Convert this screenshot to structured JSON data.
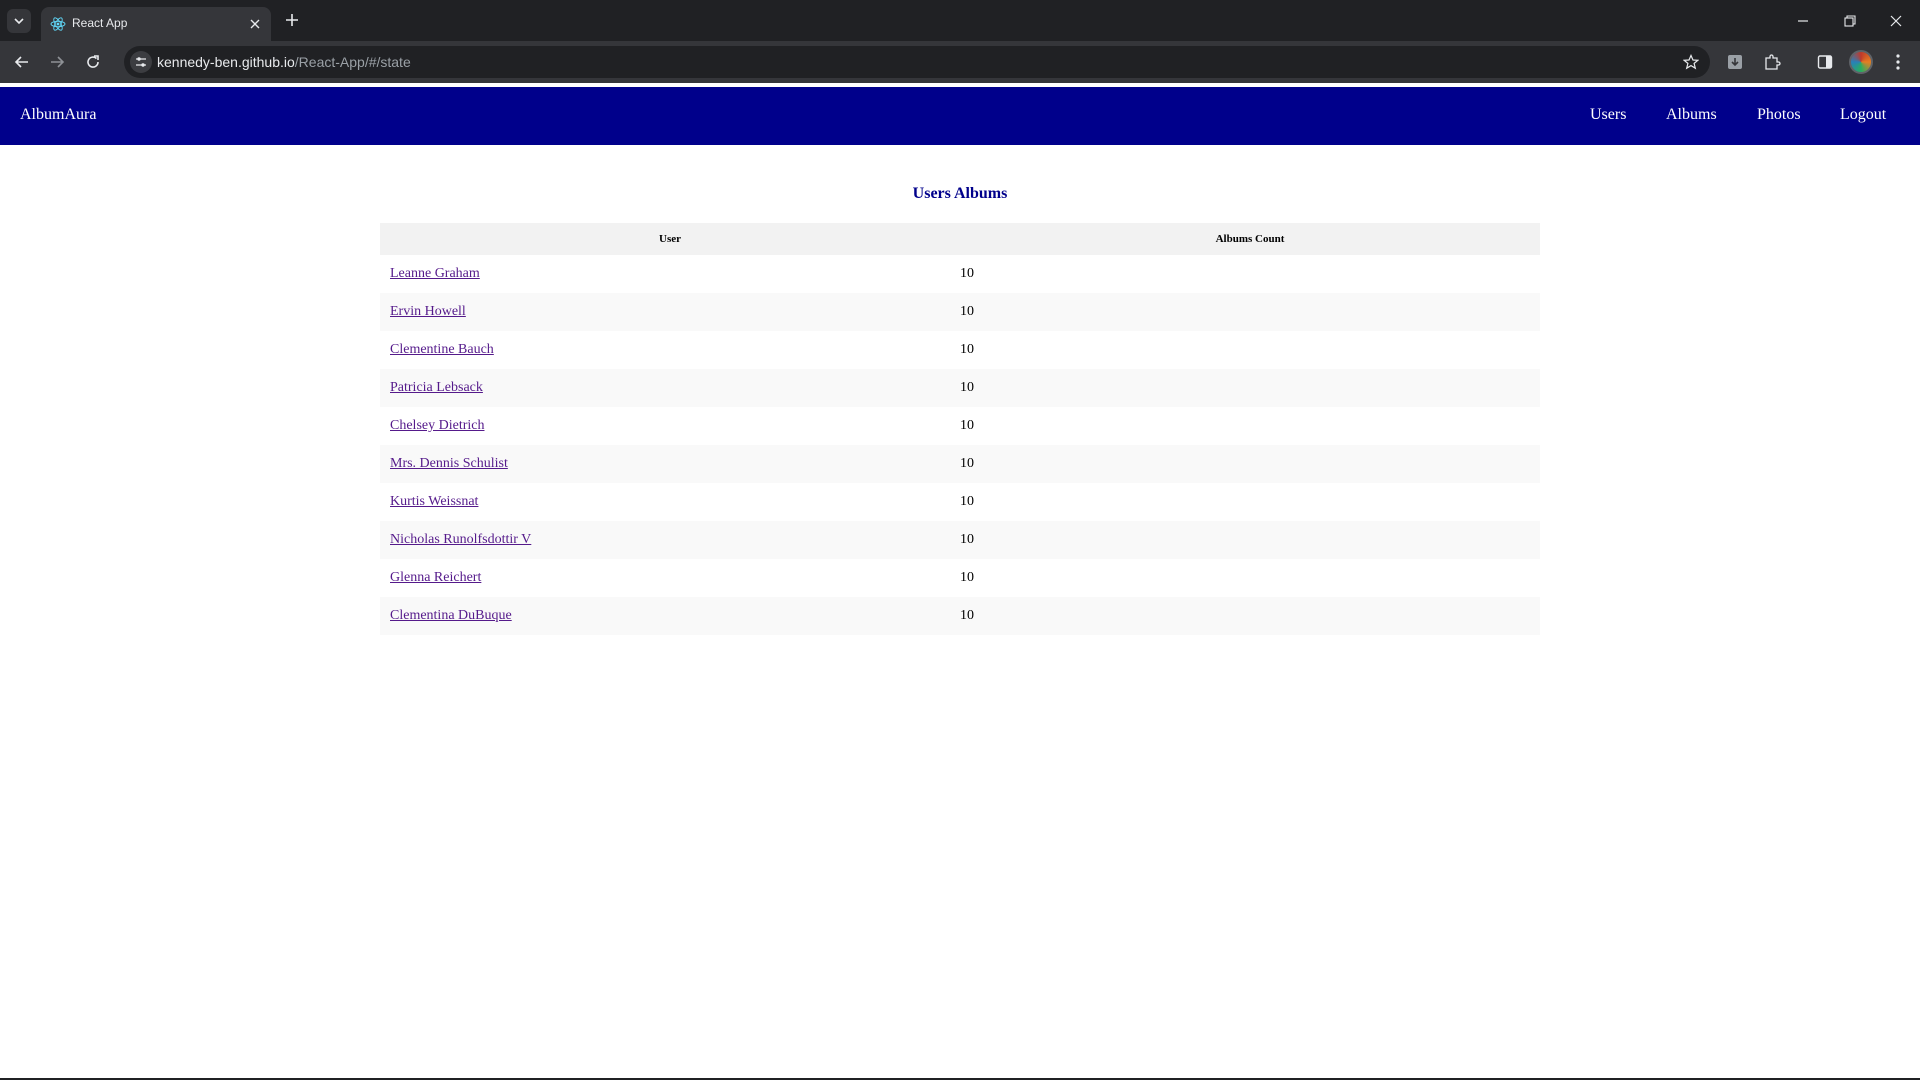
{
  "browser": {
    "tab_title": "React App",
    "url_host": "kennedy-ben.github.io",
    "url_path": "/React-App/#/state"
  },
  "app": {
    "brand": "AlbumAura",
    "nav": {
      "users": "Users",
      "albums": "Albums",
      "photos": "Photos",
      "logout": "Logout"
    },
    "page_title": "Users Albums",
    "table": {
      "headers": {
        "user": "User",
        "albums_count": "Albums Count"
      },
      "rows": [
        {
          "user": "Leanne Graham",
          "count": "10"
        },
        {
          "user": "Ervin Howell",
          "count": "10"
        },
        {
          "user": "Clementine Bauch",
          "count": "10"
        },
        {
          "user": "Patricia Lebsack",
          "count": "10"
        },
        {
          "user": "Chelsey Dietrich",
          "count": "10"
        },
        {
          "user": "Mrs. Dennis Schulist",
          "count": "10"
        },
        {
          "user": "Kurtis Weissnat",
          "count": "10"
        },
        {
          "user": "Nicholas Runolfsdottir V",
          "count": "10"
        },
        {
          "user": "Glenna Reichert",
          "count": "10"
        },
        {
          "user": "Clementina DuBuque",
          "count": "10"
        }
      ]
    }
  },
  "colors": {
    "nav_bg": "#00008b",
    "title": "#00008b",
    "link": "#551a8b",
    "header_bg": "#f2f2f2",
    "row_alt": "#f9f9f9"
  },
  "icons": {
    "tab_search": "chevron-down-icon",
    "favicon": "react-icon",
    "tab_close": "close-icon",
    "new_tab": "plus-icon",
    "back": "arrow-left-icon",
    "forward": "arrow-right-icon",
    "reload": "reload-icon",
    "site_info": "tune-icon",
    "bookmark": "star-icon",
    "download": "download-icon",
    "extensions": "puzzle-icon",
    "side_panel": "side-panel-icon",
    "profile": "avatar",
    "menu": "kebab-menu-icon"
  }
}
